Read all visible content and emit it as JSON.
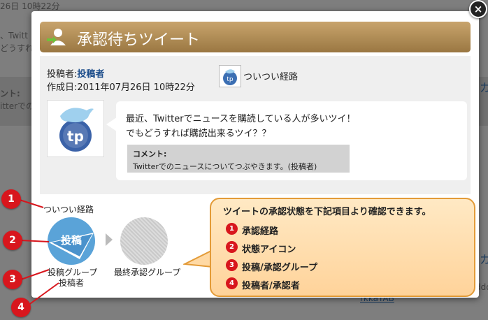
{
  "background": {
    "fragments": [
      "26日 10時22分",
      "、Twitt",
      "どうすれ",
      "ント:",
      "itterでのこ",
      "カ",
      "カ",
      "ddo",
      "rkkaYAB"
    ]
  },
  "close_glyph": "×",
  "header": {
    "title": "承認待ちツイート"
  },
  "meta": {
    "poster_label": "投稿者:",
    "poster_name": "投稿者",
    "created": "作成日:2011年07月26日 10時22分",
    "route_label": "ついつい経路"
  },
  "tweet": {
    "text": "最近、Twitterでニュースを購読している人が多いツイ！でもどうすれば購読出来るツイ？？",
    "comment_label": "コメント:",
    "comment_text": "Twitterでのニュースについてつぶやきます。(投稿者)"
  },
  "flow": {
    "route_name": "ついつい経路",
    "post_badge": "投稿",
    "group_label": "投稿グループ",
    "poster_label": "投稿者",
    "final_label": "最終承認グループ"
  },
  "callout": {
    "title": "ツイートの承認状態を下記項目より確認できます。",
    "items": [
      {
        "num": "1",
        "label": "承認経路"
      },
      {
        "num": "2",
        "label": "状態アイコン"
      },
      {
        "num": "3",
        "label": "投稿/承認グループ"
      },
      {
        "num": "4",
        "label": "投稿者/承認者"
      }
    ]
  },
  "markers": [
    "1",
    "2",
    "3",
    "4"
  ],
  "colors": {
    "header": "#b08a52",
    "marker": "#d8161d",
    "callout_border": "#e39b38",
    "poster_link": "#1f4f8c"
  }
}
